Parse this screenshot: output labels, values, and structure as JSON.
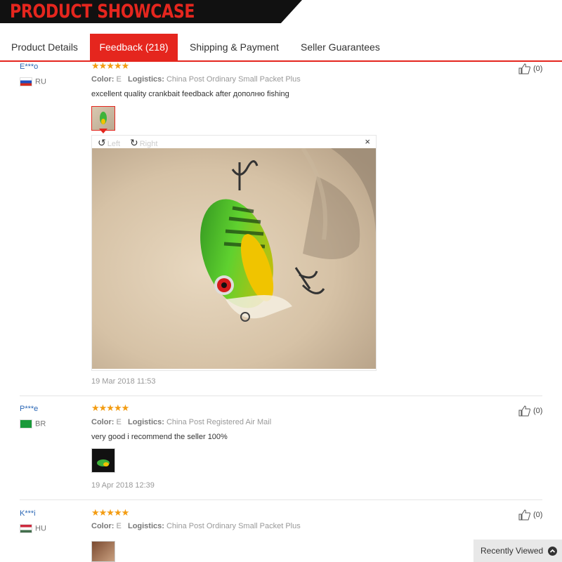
{
  "banner": {
    "title": "PRODUCT SHOWCASE"
  },
  "tabs": [
    {
      "label": "Product Details",
      "active": false
    },
    {
      "label": "Feedback (218)",
      "active": true
    },
    {
      "label": "Shipping & Payment",
      "active": false
    },
    {
      "label": "Seller Guarantees",
      "active": false
    }
  ],
  "colors": {
    "accent": "#e5261e",
    "star": "#f39c12",
    "user": "#2b67b5"
  },
  "reviews": [
    {
      "user": "E***o",
      "country": "RU",
      "stars": "★★★★★",
      "color_label": "Color:",
      "color_value": "E",
      "logistics_label": "Logistics:",
      "logistics_value": "China Post Ordinary Small Packet Plus",
      "text": "excellent quality crankbait feedback after дополню fishing",
      "date": "19 Mar 2018 11:53",
      "likes": "(0)"
    },
    {
      "user": "P***e",
      "country": "BR",
      "stars": "★★★★★",
      "color_label": "Color:",
      "color_value": "E",
      "logistics_label": "Logistics:",
      "logistics_value": "China Post Registered Air Mail",
      "text": "very good i recommend the seller 100%",
      "date": "19 Apr 2018 12:39",
      "likes": "(0)"
    },
    {
      "user": "K***i",
      "country": "HU",
      "stars": "★★★★★",
      "color_label": "Color:",
      "color_value": "E",
      "logistics_label": "Logistics:",
      "logistics_value": "China Post Ordinary Small Packet Plus",
      "likes": "(0)"
    }
  ],
  "viewer": {
    "rotate_left": "Left",
    "rotate_right": "Right",
    "close": "×"
  },
  "recently_viewed": {
    "label": "Recently Viewed"
  }
}
